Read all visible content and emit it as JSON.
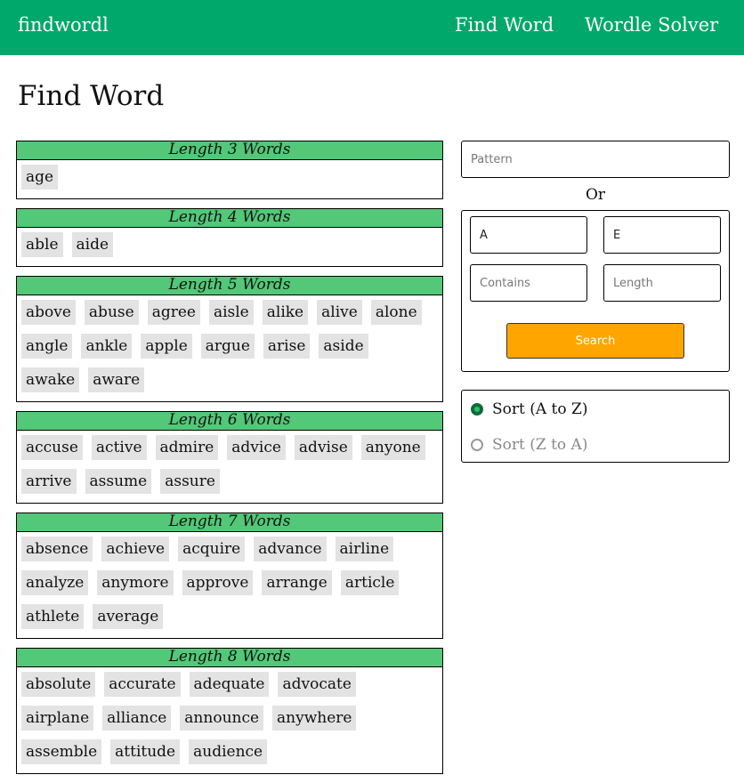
{
  "header": {
    "brand": "findwordl",
    "nav": [
      "Find Word",
      "Wordle Solver"
    ],
    "colors": {
      "bar": "#00a86b",
      "text": "#ffffff"
    }
  },
  "page": {
    "title": "Find Word"
  },
  "groups": [
    {
      "title": "Length 3 Words",
      "words": [
        "age"
      ]
    },
    {
      "title": "Length 4 Words",
      "words": [
        "able",
        "aide"
      ]
    },
    {
      "title": "Length 5 Words",
      "words": [
        "above",
        "abuse",
        "agree",
        "aisle",
        "alike",
        "alive",
        "alone",
        "angle",
        "ankle",
        "apple",
        "argue",
        "arise",
        "aside",
        "awake",
        "aware"
      ]
    },
    {
      "title": "Length 6 Words",
      "words": [
        "accuse",
        "active",
        "admire",
        "advice",
        "advise",
        "anyone",
        "arrive",
        "assume",
        "assure"
      ]
    },
    {
      "title": "Length 7 Words",
      "words": [
        "absence",
        "achieve",
        "acquire",
        "advance",
        "airline",
        "analyze",
        "anymore",
        "approve",
        "arrange",
        "article",
        "athlete",
        "average"
      ]
    },
    {
      "title": "Length 8 Words",
      "words": [
        "absolute",
        "accurate",
        "adequate",
        "advocate",
        "airplane",
        "alliance",
        "announce",
        "anywhere",
        "assemble",
        "attitude",
        "audience"
      ]
    }
  ],
  "group_header_color": "#52c878",
  "word_chip_color": "#e3e3e3",
  "search": {
    "pattern_placeholder": "Pattern",
    "or_label": "Or",
    "starts_with_value": "A",
    "ends_with_value": "E",
    "contains_placeholder": "Contains",
    "length_placeholder": "Length",
    "button_label": "Search",
    "button_color": "#ffa500"
  },
  "sort": {
    "options": [
      "Sort (A to Z)",
      "Sort (Z to A)"
    ],
    "selected": "Sort (A to Z)"
  }
}
